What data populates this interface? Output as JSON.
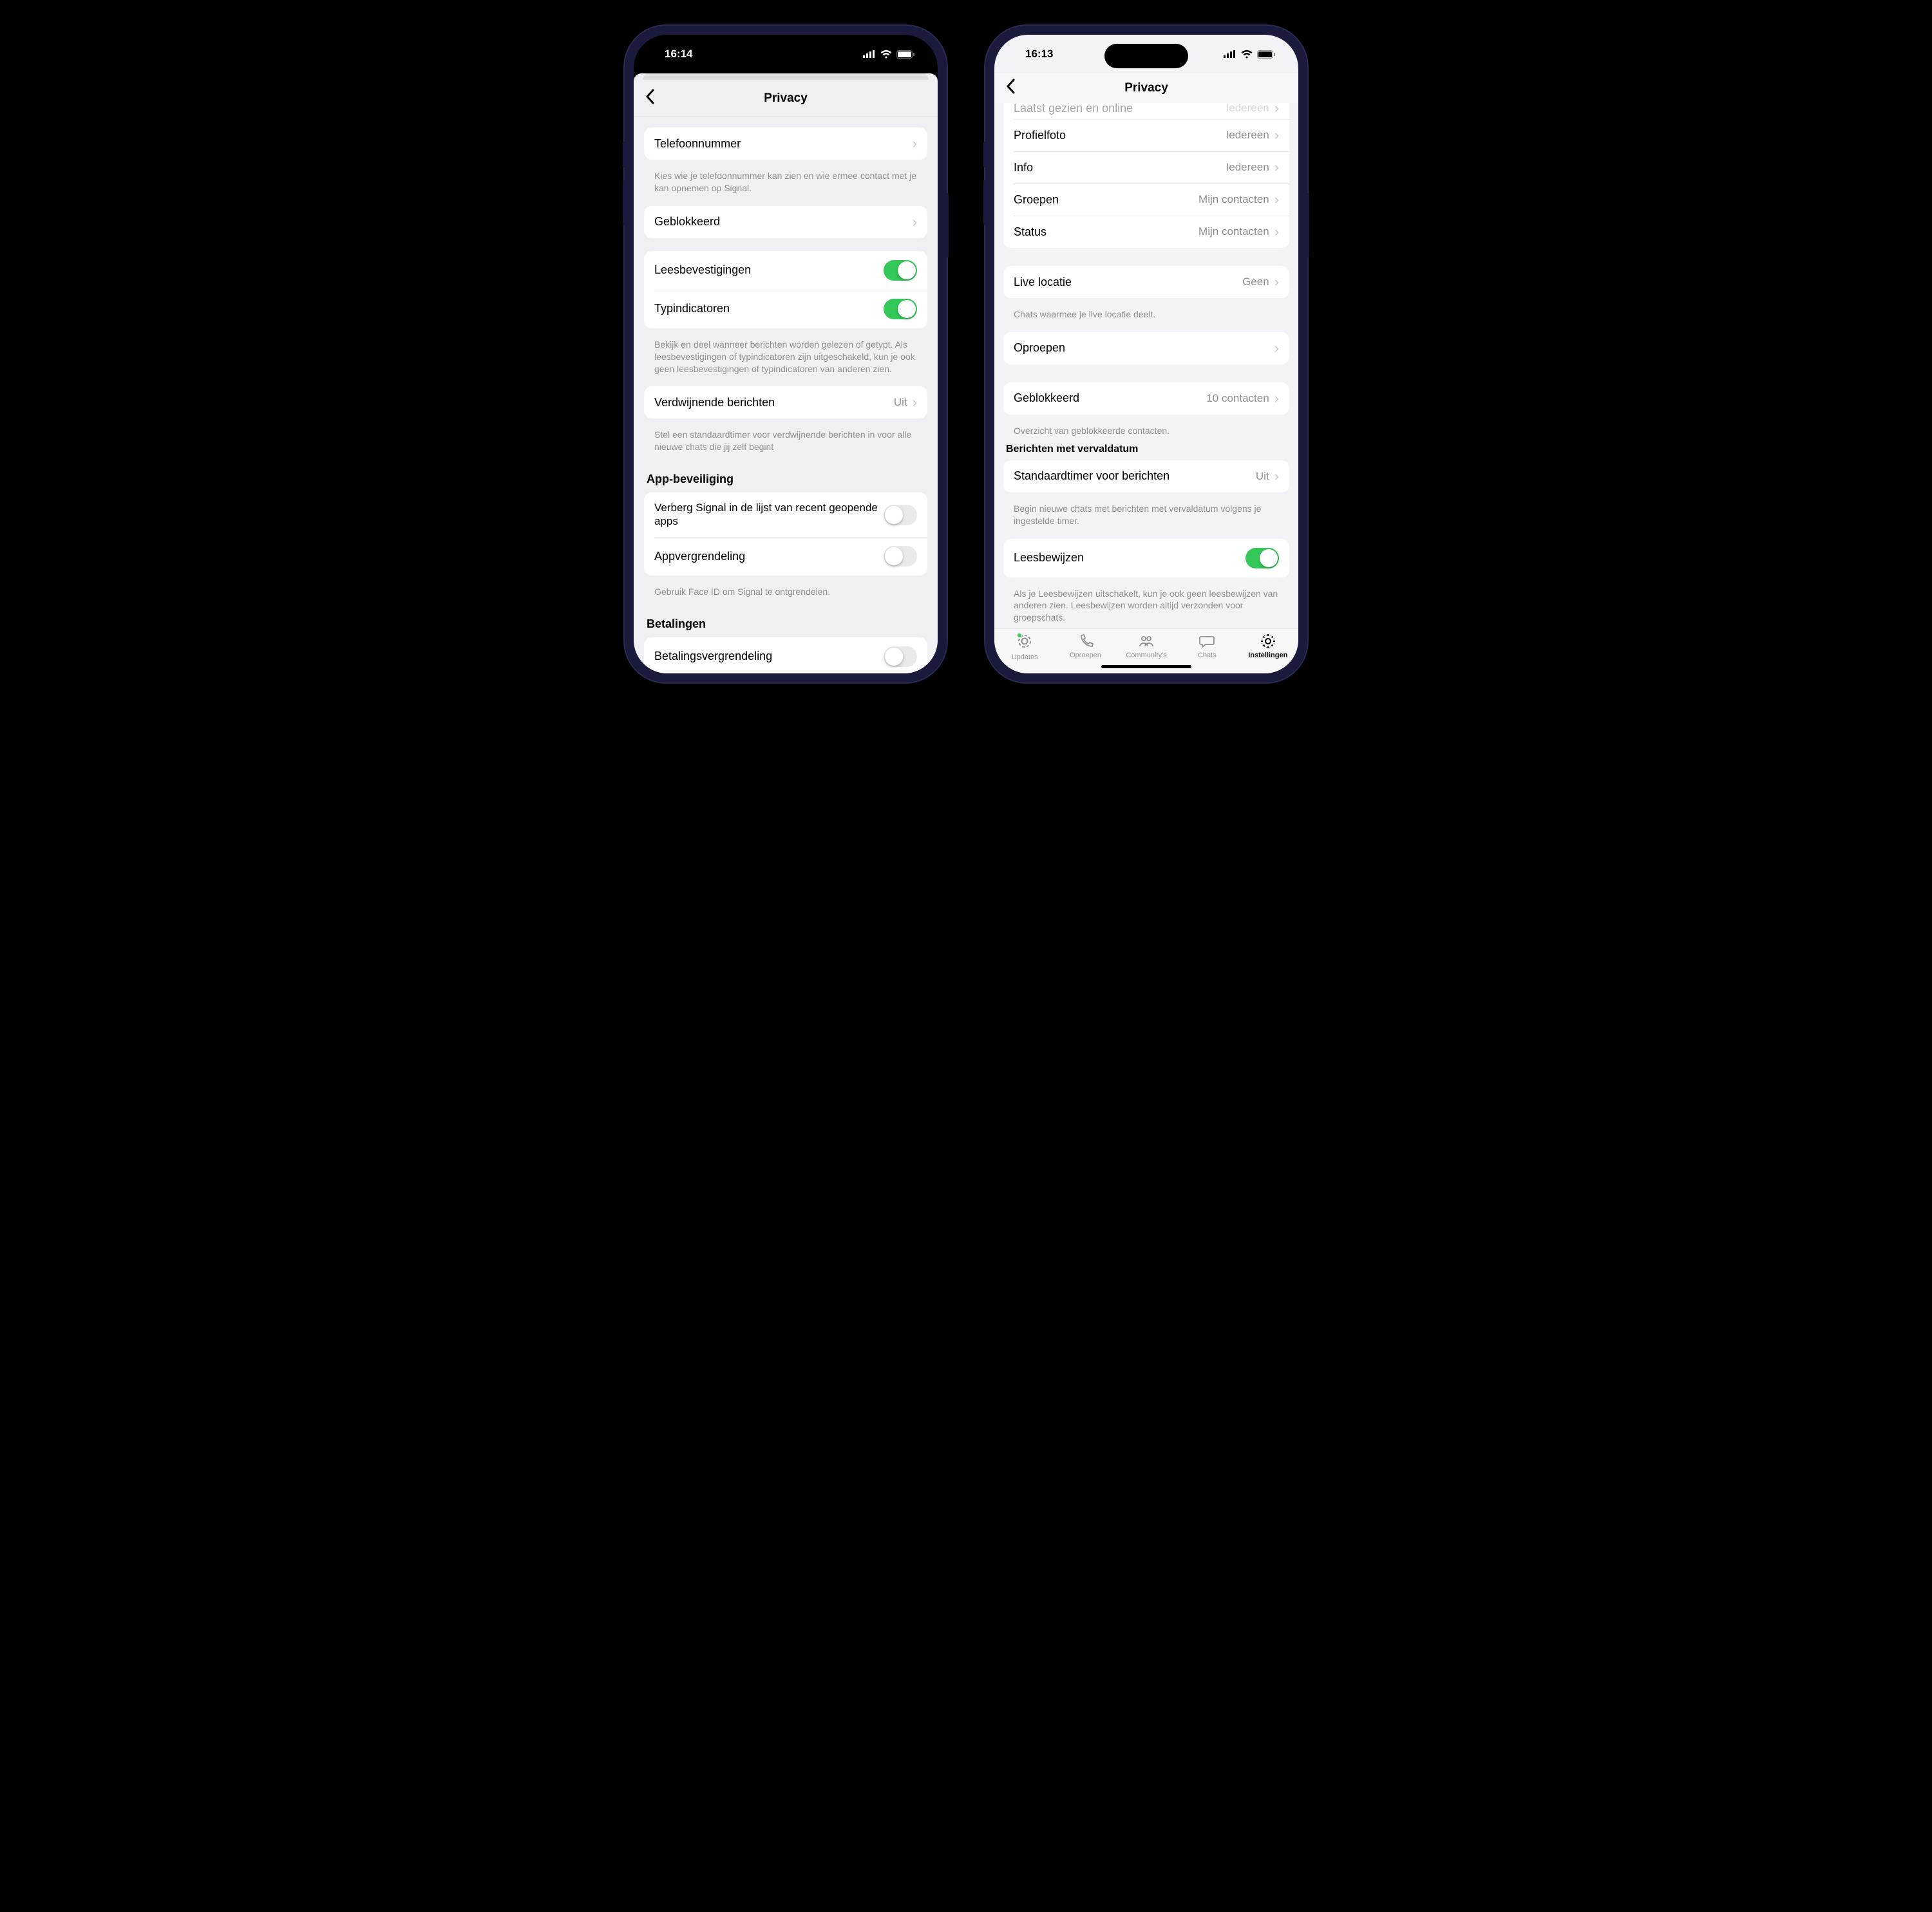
{
  "left": {
    "time": "16:14",
    "title": "Privacy",
    "sections": {
      "phone": {
        "label": "Telefoonnummer",
        "footer": "Kies wie je telefoonnummer kan zien en wie ermee contact met je kan opnemen op Signal."
      },
      "blocked": {
        "label": "Geblokkeerd"
      },
      "readReceipts": {
        "label": "Leesbevestigingen"
      },
      "typing": {
        "label": "Typindicatoren"
      },
      "indicators_footer": "Bekijk en deel wanneer berichten worden gelezen of getypt. Als leesbevestigingen of typindicatoren zijn uitgeschakeld, kun je ook geen leesbevestigingen of typindicatoren van anderen zien.",
      "disappearing": {
        "label": "Verdwijnende berichten",
        "value": "Uit"
      },
      "disappearing_footer": "Stel een standaardtimer voor verdwijnende berichten in voor alle nieuwe chats die jij zelf begint",
      "appsec_header": "App-beveiliging",
      "hideRecent": {
        "label": "Verberg Signal in de lijst van recent geopende apps"
      },
      "appLock": {
        "label": "Appvergrendeling"
      },
      "appLock_footer": "Gebruik Face ID om Signal te ontgrendelen.",
      "payments_header": "Betalingen",
      "paymentsLock": {
        "label": "Betalingsvergrendeling"
      }
    }
  },
  "right": {
    "time": "16:13",
    "title": "Privacy",
    "rows": {
      "lastSeenCut": {
        "label": "Laatst gezien en online",
        "value": "Iedereen"
      },
      "profilePhoto": {
        "label": "Profielfoto",
        "value": "Iedereen"
      },
      "info": {
        "label": "Info",
        "value": "Iedereen"
      },
      "groups": {
        "label": "Groepen",
        "value": "Mijn contacten"
      },
      "status": {
        "label": "Status",
        "value": "Mijn contacten"
      },
      "liveLocation": {
        "label": "Live locatie",
        "value": "Geen"
      },
      "liveLocation_footer": "Chats waarmee je live locatie deelt.",
      "calls": {
        "label": "Oproepen"
      },
      "blocked": {
        "label": "Geblokkeerd",
        "value": "10 contacten"
      },
      "blocked_footer": "Overzicht van geblokkeerde contacten.",
      "expiry_header": "Berichten met vervaldatum",
      "defaultTimer": {
        "label": "Standaardtimer voor berichten",
        "value": "Uit"
      },
      "defaultTimer_footer": "Begin nieuwe chats met berichten met vervaldatum volgens je ingestelde timer.",
      "readReceipts": {
        "label": "Leesbewijzen"
      },
      "readReceipts_footer": "Als je Leesbewijzen uitschakelt, kun je ook geen leesbewijzen van anderen zien. Leesbewijzen worden altijd verzonden voor groepschats."
    },
    "tabs": {
      "updates": "Updates",
      "calls": "Oproepen",
      "communities": "Community's",
      "chats": "Chats",
      "settings": "Instellingen"
    }
  }
}
